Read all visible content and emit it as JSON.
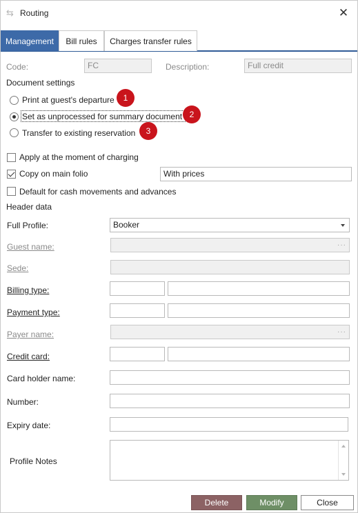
{
  "window": {
    "title": "Routing",
    "app_icon": "routing-icon",
    "close_icon": "close-icon"
  },
  "tabs": [
    {
      "label": "Management",
      "active": true
    },
    {
      "label": "Bill rules",
      "active": false
    },
    {
      "label": "Charges transfer rules",
      "active": false
    }
  ],
  "code": {
    "label": "Code:",
    "value": "FC"
  },
  "description": {
    "label": "Description:",
    "value": "Full credit"
  },
  "document_settings": {
    "heading": "Document settings",
    "options": [
      {
        "label": "Print at guest's departure",
        "selected": false,
        "badge": "1"
      },
      {
        "label": "Set as unprocessed for summary document",
        "selected": true,
        "badge": "2"
      },
      {
        "label": "Transfer to existing reservation",
        "selected": false,
        "badge": "3"
      }
    ]
  },
  "checks": {
    "apply_moment": {
      "label": "Apply at the moment of charging",
      "checked": false
    },
    "copy_main_folio": {
      "label": "Copy on main folio",
      "checked": true,
      "value": "With prices"
    },
    "default_cash": {
      "label": "Default for cash movements and advances",
      "checked": false
    }
  },
  "header_data": {
    "heading": "Header data",
    "full_profile": {
      "label": "Full Profile:",
      "value": "Booker"
    },
    "guest_name": {
      "label": "Guest name:",
      "value": ""
    },
    "sede": {
      "label": "Sede:",
      "value": ""
    },
    "billing_type": {
      "label": "Billing type:",
      "code": "",
      "name": ""
    },
    "payment_type": {
      "label": "Payment type:",
      "code": "",
      "name": ""
    },
    "payer_name": {
      "label": "Payer name:",
      "value": ""
    },
    "credit_card": {
      "label": "Credit card:",
      "code": "",
      "name": ""
    },
    "card_holder": {
      "label": "Card holder name:",
      "value": ""
    },
    "number": {
      "label": "Number:",
      "value": ""
    },
    "expiry": {
      "label": "Expiry date:",
      "value": ""
    },
    "profile_notes": {
      "label": "Profile Notes",
      "value": ""
    }
  },
  "buttons": {
    "delete": "Delete",
    "modify": "Modify",
    "close": "Close"
  },
  "colors": {
    "tab_active": "#3d6aa8",
    "badge": "#c9141c",
    "delete": "#8c6264",
    "modify": "#6e8f66"
  }
}
